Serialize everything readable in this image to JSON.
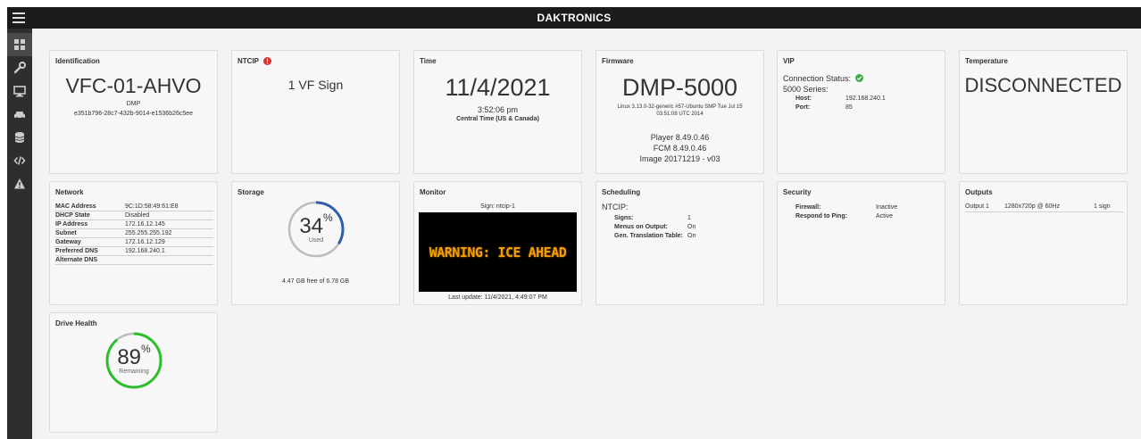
{
  "header": {
    "brand": "DAKTRONICS"
  },
  "sidebar": {
    "items": [
      {
        "name": "dashboard-icon"
      },
      {
        "name": "wrench-icon"
      },
      {
        "name": "monitor-icon"
      },
      {
        "name": "car-icon"
      },
      {
        "name": "database-icon"
      },
      {
        "name": "code-icon"
      },
      {
        "name": "warning-icon"
      }
    ]
  },
  "identification": {
    "title": "Identification",
    "name": "VFC-01-AHVO",
    "model": "DMP",
    "guid": "e351b796-28c7-432b-9014-e1536b26c5ee"
  },
  "ntcip": {
    "title": "NTCIP",
    "value": "1 VF Sign",
    "alert_color": "#d9302c"
  },
  "time": {
    "title": "Time",
    "date": "11/4/2021",
    "clock": "3:52:06 pm",
    "zone": "Central Time (US & Canada)"
  },
  "firmware": {
    "title": "Firmware",
    "model": "DMP-5000",
    "kernel_line1": "Linux 3.13.0-32-generic #57-Ubuntu SMP Tue Jul 15",
    "kernel_line2": "03:51:08 UTC 2014",
    "player": "Player 8.49.0.46",
    "fcm": "FCM 8.49.0.46",
    "image": "Image 20171219 - v03"
  },
  "vip": {
    "title": "VIP",
    "connection_label": "Connection Status:",
    "series": "5000 Series:",
    "host_label": "Host:",
    "host": "192.168.240.1",
    "port_label": "Port:",
    "port": "85",
    "ok_color": "#3fae49"
  },
  "temperature": {
    "title": "Temperature",
    "value": "DISCONNECTED"
  },
  "network": {
    "title": "Network",
    "rows": [
      {
        "k": "MAC Address",
        "v": "9C:1D:58:49:61:E8"
      },
      {
        "k": "DHCP State",
        "v": "Disabled"
      },
      {
        "k": "IP Address",
        "v": "172.16.12.145"
      },
      {
        "k": "Subnet",
        "v": "255.255.255.192"
      },
      {
        "k": "Gateway",
        "v": "172.16.12.129"
      },
      {
        "k": "Preferred DNS",
        "v": "192.168.240.1"
      },
      {
        "k": "Alternate DNS",
        "v": ""
      }
    ]
  },
  "storage": {
    "title": "Storage",
    "percent": 34,
    "percent_text": "34",
    "pct_sign": "%",
    "label": "Used",
    "free": "4.47 GB free of 6.78 GB",
    "color": "#2e5ea8"
  },
  "monitor": {
    "title": "Monitor",
    "sign": "Sign: ntcip-1",
    "message": "WARNING: ICE AHEAD",
    "last_update": "Last update: 11/4/2021, 4:49:07 PM",
    "message_color": "#f0a100"
  },
  "scheduling": {
    "title": "Scheduling",
    "ntcip": "NTCIP:",
    "rows": [
      {
        "k": "Signs:",
        "v": "1"
      },
      {
        "k": "Menus on Output:",
        "v": "On"
      },
      {
        "k": "Gen. Translation Table:",
        "v": "On"
      }
    ]
  },
  "security": {
    "title": "Security",
    "rows": [
      {
        "k": "Firewall:",
        "v": "Inactive"
      },
      {
        "k": "Respond to Ping:",
        "v": "Active"
      }
    ]
  },
  "outputs": {
    "title": "Outputs",
    "name": "Output 1",
    "resolution": "1280x720p @ 60Hz",
    "signs": "1 sign"
  },
  "drive_health": {
    "title": "Drive Health",
    "percent": 89,
    "percent_text": "89",
    "pct_sign": "%",
    "label": "Remaining",
    "color": "#2bbf2b"
  }
}
